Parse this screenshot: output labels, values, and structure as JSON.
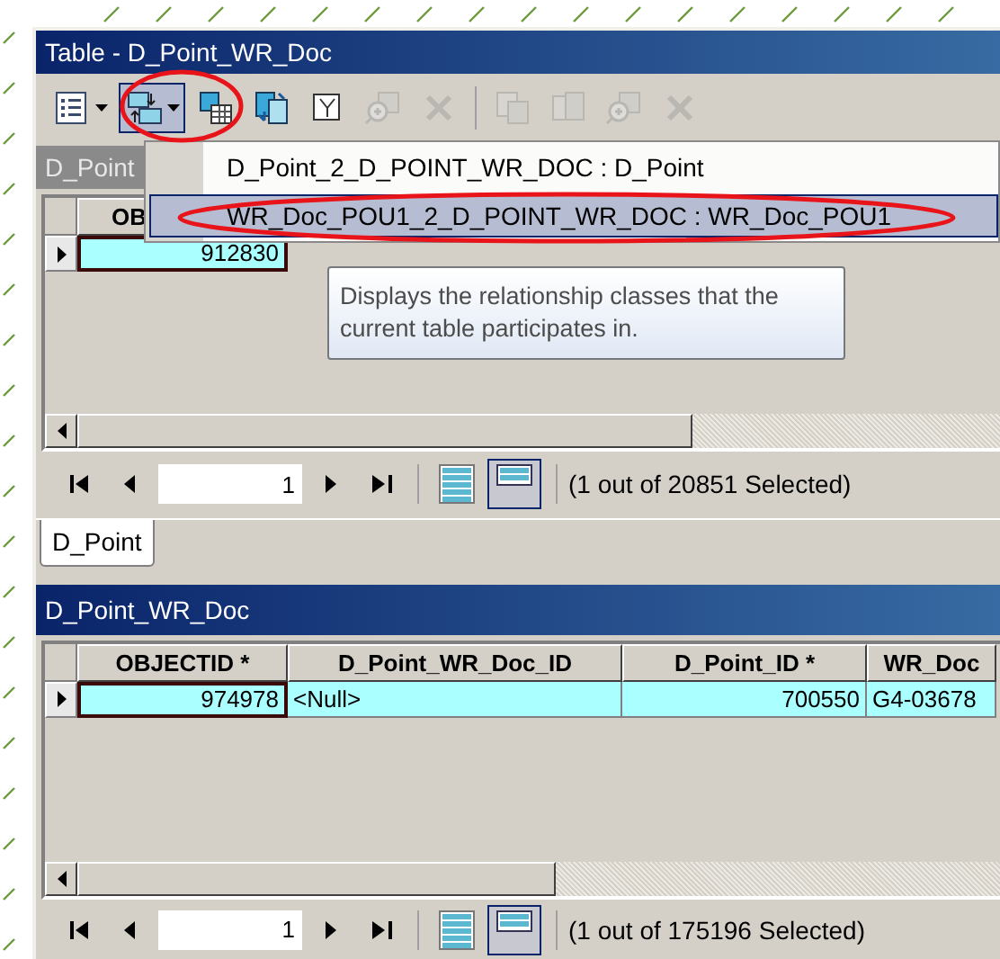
{
  "window": {
    "title": "Table - D_Point_WR_Doc"
  },
  "toolbar": {
    "groups": [
      [
        {
          "kind": "options",
          "disabled": false,
          "pressed": false,
          "dropdown": true
        },
        {
          "kind": "related",
          "disabled": false,
          "pressed": true,
          "dropdown": true
        },
        {
          "kind": "select-attributes",
          "disabled": false,
          "pressed": false,
          "dropdown": false
        },
        {
          "kind": "switch",
          "disabled": false,
          "pressed": false,
          "dropdown": false
        },
        {
          "kind": "clear",
          "disabled": false,
          "pressed": false,
          "dropdown": false
        },
        {
          "kind": "zoom",
          "disabled": true,
          "pressed": false,
          "dropdown": false
        },
        {
          "kind": "delete",
          "disabled": true,
          "pressed": false,
          "dropdown": false
        }
      ],
      [
        {
          "kind": "copy",
          "disabled": true,
          "pressed": false,
          "dropdown": false
        },
        {
          "kind": "paste",
          "disabled": true,
          "pressed": false,
          "dropdown": false
        },
        {
          "kind": "zoom",
          "disabled": true,
          "pressed": false,
          "dropdown": false
        },
        {
          "kind": "delete",
          "disabled": true,
          "pressed": false,
          "dropdown": false
        }
      ]
    ]
  },
  "dropdown_menu": {
    "items": [
      {
        "label": "D_Point_2_D_POINT_WR_DOC : D_Point",
        "selected": false
      },
      {
        "label": "WR_Doc_POU1_2_D_POINT_WR_DOC : WR_Doc_POU1",
        "selected": true
      }
    ]
  },
  "tooltip": "Displays the relationship classes that the current table participates in.",
  "top_table": {
    "title": "D_Point",
    "active": false,
    "columns": [
      "OB"
    ],
    "rows": [
      {
        "cells": [
          "912830"
        ],
        "selected": true
      }
    ],
    "record": "1",
    "views": [
      {
        "kind": "all",
        "selected": false
      },
      {
        "kind": "selected",
        "selected": true
      }
    ],
    "status": "(1 out of 20851 Selected)"
  },
  "tabs": [
    {
      "label": "D_Point",
      "selected": true
    }
  ],
  "bottom_table": {
    "title": "D_Point_WR_Doc",
    "active": true,
    "columns": [
      "OBJECTID *",
      "D_Point_WR_Doc_ID",
      "D_Point_ID *",
      "WR_Doc"
    ],
    "rows": [
      {
        "cells": [
          "974978",
          "<Null>",
          "700550",
          "G4-03678"
        ],
        "selected": true
      }
    ],
    "record": "1",
    "views": [
      {
        "kind": "all",
        "selected": false
      },
      {
        "kind": "selected",
        "selected": true
      }
    ],
    "status": "(1 out of 175196 Selected)"
  }
}
